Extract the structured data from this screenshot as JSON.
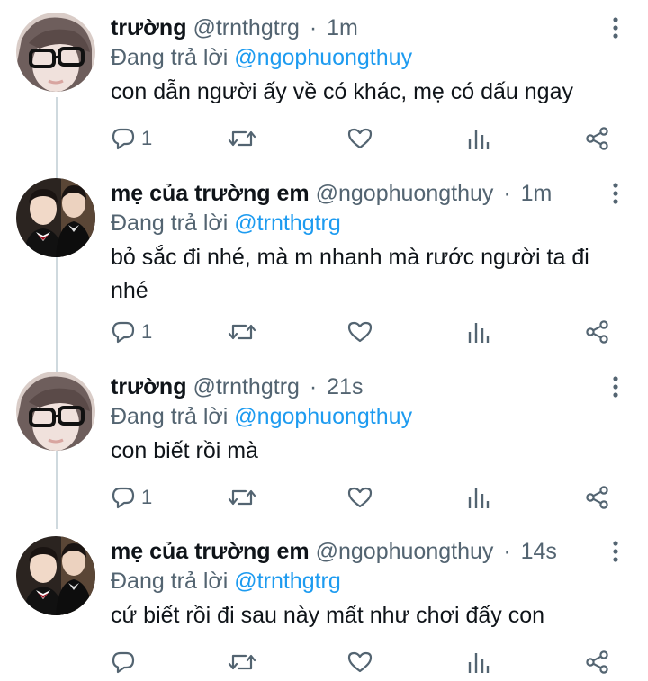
{
  "tweets": [
    {
      "name": "trường",
      "handle": "@trnthgtrg",
      "dot": "·",
      "time": "1m",
      "replying_prefix": "Đang trả lời",
      "replying_to": "@ngophuongthuy",
      "text": "con dẫn người ấy về có khác, mẹ có dấu ngay",
      "reply_count": "1",
      "avatar_icon": "avatar-glasses-person"
    },
    {
      "name": "mẹ của trường em",
      "handle": "@ngophuongthuy",
      "dot": "·",
      "time": "1m",
      "replying_prefix": "Đang trả lời",
      "replying_to": "@trnthgtrg",
      "text": "bỏ sắc đi nhé, mà m nhanh mà rước người ta đi nhé",
      "reply_count": "1",
      "avatar_icon": "avatar-two-boys"
    },
    {
      "name": "trường",
      "handle": "@trnthgtrg",
      "dot": "·",
      "time": "21s",
      "replying_prefix": "Đang trả lời",
      "replying_to": "@ngophuongthuy",
      "text": "con biết rồi mà",
      "reply_count": "1",
      "avatar_icon": "avatar-glasses-person"
    },
    {
      "name": "mẹ của trường em",
      "handle": "@ngophuongthuy",
      "dot": "·",
      "time": "14s",
      "replying_prefix": "Đang trả lời",
      "replying_to": "@trnthgtrg",
      "text": "cứ biết rồi đi sau này mất như chơi đấy con",
      "reply_count": "",
      "avatar_icon": "avatar-two-boys"
    }
  ],
  "colors": {
    "text": "#0f1419",
    "secondary": "#536471",
    "mention": "#1d9bf0",
    "thread_line": "#cfd9de"
  },
  "icons": [
    "reply-icon",
    "retweet-icon",
    "like-icon",
    "analytics-icon",
    "share-icon",
    "more-icon"
  ]
}
